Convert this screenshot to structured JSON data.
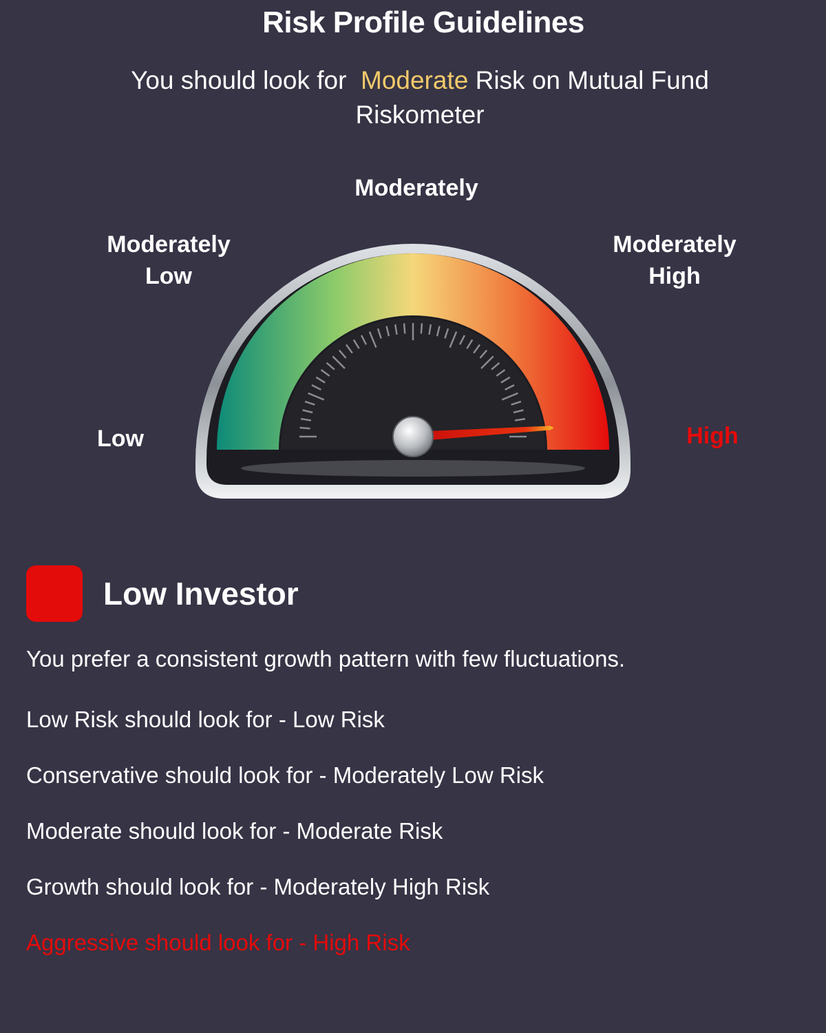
{
  "title": "Risk Profile Guidelines",
  "recommendation": {
    "prefix": "You should look for",
    "level": "Moderate",
    "suffix": "Risk on Mutual Fund",
    "suffix_line2": "Riskometer",
    "highlight_color": "#f3c96a"
  },
  "riskometer": {
    "labels": {
      "low": "Low",
      "moderately_low_1": "Moderately",
      "moderately_low_2": "Low",
      "moderately": "Moderately",
      "moderately_high_1": "Moderately",
      "moderately_high_2": "High",
      "high": "High"
    },
    "needle_level": "High",
    "needle_fraction": 0.98,
    "colors": {
      "low": "#0d8a78",
      "moderately_low": "#8ccb6a",
      "moderate": "#f5d77a",
      "moderately_high": "#f07a3c",
      "high": "#e40b0b"
    }
  },
  "investor": {
    "name": "Low Investor",
    "swatch_color": "#e40b0b",
    "description": "You prefer a consistent growth pattern with few fluctuations."
  },
  "guidelines": [
    {
      "text": "Low Risk should look for - Low Risk",
      "highlighted": false
    },
    {
      "text": "Conservative should look for - Moderately Low Risk",
      "highlighted": false
    },
    {
      "text": "Moderate should look for - Moderate  Risk",
      "highlighted": false
    },
    {
      "text": "Growth should look for - Moderately High Risk",
      "highlighted": false
    },
    {
      "text": "Aggressive should look for - High Risk",
      "highlighted": true
    }
  ]
}
